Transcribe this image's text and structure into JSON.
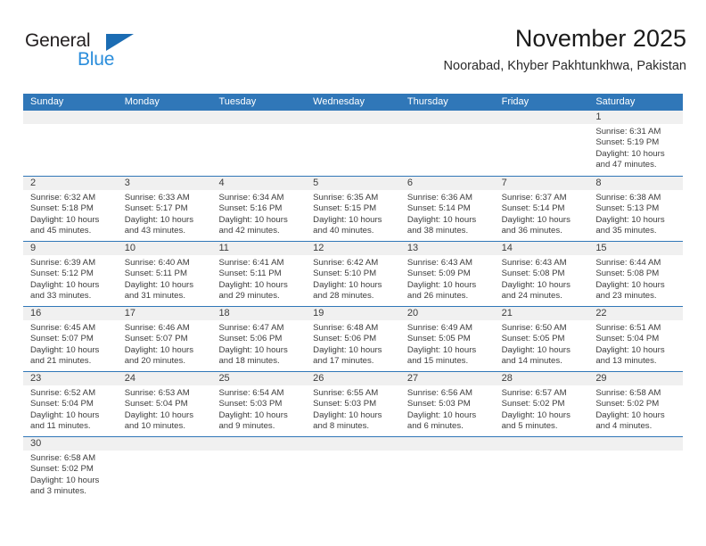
{
  "logo": {
    "word_top": "General",
    "word_bottom": "Blue",
    "triangle_color": "#1b6cb3",
    "blue_text_color": "#2a8ddb"
  },
  "header": {
    "title": "November 2025",
    "subtitle": "Noorabad, Khyber Pakhtunkhwa, Pakistan"
  },
  "theme": {
    "header_blue": "#3077b8",
    "day_band_gray": "#f0f0f0",
    "text_color": "#3c3c3c"
  },
  "weekdays": [
    "Sunday",
    "Monday",
    "Tuesday",
    "Wednesday",
    "Thursday",
    "Friday",
    "Saturday"
  ],
  "weeks": [
    [
      {
        "day": "",
        "empty": true,
        "sunrise": "",
        "sunset": "",
        "daylight_line1": "",
        "daylight_line2": ""
      },
      {
        "day": "",
        "empty": true,
        "sunrise": "",
        "sunset": "",
        "daylight_line1": "",
        "daylight_line2": ""
      },
      {
        "day": "",
        "empty": true,
        "sunrise": "",
        "sunset": "",
        "daylight_line1": "",
        "daylight_line2": ""
      },
      {
        "day": "",
        "empty": true,
        "sunrise": "",
        "sunset": "",
        "daylight_line1": "",
        "daylight_line2": ""
      },
      {
        "day": "",
        "empty": true,
        "sunrise": "",
        "sunset": "",
        "daylight_line1": "",
        "daylight_line2": ""
      },
      {
        "day": "",
        "empty": true,
        "sunrise": "",
        "sunset": "",
        "daylight_line1": "",
        "daylight_line2": ""
      },
      {
        "day": "1",
        "empty": false,
        "sunrise": "Sunrise: 6:31 AM",
        "sunset": "Sunset: 5:19 PM",
        "daylight_line1": "Daylight: 10 hours",
        "daylight_line2": "and 47 minutes."
      }
    ],
    [
      {
        "day": "2",
        "empty": false,
        "sunrise": "Sunrise: 6:32 AM",
        "sunset": "Sunset: 5:18 PM",
        "daylight_line1": "Daylight: 10 hours",
        "daylight_line2": "and 45 minutes."
      },
      {
        "day": "3",
        "empty": false,
        "sunrise": "Sunrise: 6:33 AM",
        "sunset": "Sunset: 5:17 PM",
        "daylight_line1": "Daylight: 10 hours",
        "daylight_line2": "and 43 minutes."
      },
      {
        "day": "4",
        "empty": false,
        "sunrise": "Sunrise: 6:34 AM",
        "sunset": "Sunset: 5:16 PM",
        "daylight_line1": "Daylight: 10 hours",
        "daylight_line2": "and 42 minutes."
      },
      {
        "day": "5",
        "empty": false,
        "sunrise": "Sunrise: 6:35 AM",
        "sunset": "Sunset: 5:15 PM",
        "daylight_line1": "Daylight: 10 hours",
        "daylight_line2": "and 40 minutes."
      },
      {
        "day": "6",
        "empty": false,
        "sunrise": "Sunrise: 6:36 AM",
        "sunset": "Sunset: 5:14 PM",
        "daylight_line1": "Daylight: 10 hours",
        "daylight_line2": "and 38 minutes."
      },
      {
        "day": "7",
        "empty": false,
        "sunrise": "Sunrise: 6:37 AM",
        "sunset": "Sunset: 5:14 PM",
        "daylight_line1": "Daylight: 10 hours",
        "daylight_line2": "and 36 minutes."
      },
      {
        "day": "8",
        "empty": false,
        "sunrise": "Sunrise: 6:38 AM",
        "sunset": "Sunset: 5:13 PM",
        "daylight_line1": "Daylight: 10 hours",
        "daylight_line2": "and 35 minutes."
      }
    ],
    [
      {
        "day": "9",
        "empty": false,
        "sunrise": "Sunrise: 6:39 AM",
        "sunset": "Sunset: 5:12 PM",
        "daylight_line1": "Daylight: 10 hours",
        "daylight_line2": "and 33 minutes."
      },
      {
        "day": "10",
        "empty": false,
        "sunrise": "Sunrise: 6:40 AM",
        "sunset": "Sunset: 5:11 PM",
        "daylight_line1": "Daylight: 10 hours",
        "daylight_line2": "and 31 minutes."
      },
      {
        "day": "11",
        "empty": false,
        "sunrise": "Sunrise: 6:41 AM",
        "sunset": "Sunset: 5:11 PM",
        "daylight_line1": "Daylight: 10 hours",
        "daylight_line2": "and 29 minutes."
      },
      {
        "day": "12",
        "empty": false,
        "sunrise": "Sunrise: 6:42 AM",
        "sunset": "Sunset: 5:10 PM",
        "daylight_line1": "Daylight: 10 hours",
        "daylight_line2": "and 28 minutes."
      },
      {
        "day": "13",
        "empty": false,
        "sunrise": "Sunrise: 6:43 AM",
        "sunset": "Sunset: 5:09 PM",
        "daylight_line1": "Daylight: 10 hours",
        "daylight_line2": "and 26 minutes."
      },
      {
        "day": "14",
        "empty": false,
        "sunrise": "Sunrise: 6:43 AM",
        "sunset": "Sunset: 5:08 PM",
        "daylight_line1": "Daylight: 10 hours",
        "daylight_line2": "and 24 minutes."
      },
      {
        "day": "15",
        "empty": false,
        "sunrise": "Sunrise: 6:44 AM",
        "sunset": "Sunset: 5:08 PM",
        "daylight_line1": "Daylight: 10 hours",
        "daylight_line2": "and 23 minutes."
      }
    ],
    [
      {
        "day": "16",
        "empty": false,
        "sunrise": "Sunrise: 6:45 AM",
        "sunset": "Sunset: 5:07 PM",
        "daylight_line1": "Daylight: 10 hours",
        "daylight_line2": "and 21 minutes."
      },
      {
        "day": "17",
        "empty": false,
        "sunrise": "Sunrise: 6:46 AM",
        "sunset": "Sunset: 5:07 PM",
        "daylight_line1": "Daylight: 10 hours",
        "daylight_line2": "and 20 minutes."
      },
      {
        "day": "18",
        "empty": false,
        "sunrise": "Sunrise: 6:47 AM",
        "sunset": "Sunset: 5:06 PM",
        "daylight_line1": "Daylight: 10 hours",
        "daylight_line2": "and 18 minutes."
      },
      {
        "day": "19",
        "empty": false,
        "sunrise": "Sunrise: 6:48 AM",
        "sunset": "Sunset: 5:06 PM",
        "daylight_line1": "Daylight: 10 hours",
        "daylight_line2": "and 17 minutes."
      },
      {
        "day": "20",
        "empty": false,
        "sunrise": "Sunrise: 6:49 AM",
        "sunset": "Sunset: 5:05 PM",
        "daylight_line1": "Daylight: 10 hours",
        "daylight_line2": "and 15 minutes."
      },
      {
        "day": "21",
        "empty": false,
        "sunrise": "Sunrise: 6:50 AM",
        "sunset": "Sunset: 5:05 PM",
        "daylight_line1": "Daylight: 10 hours",
        "daylight_line2": "and 14 minutes."
      },
      {
        "day": "22",
        "empty": false,
        "sunrise": "Sunrise: 6:51 AM",
        "sunset": "Sunset: 5:04 PM",
        "daylight_line1": "Daylight: 10 hours",
        "daylight_line2": "and 13 minutes."
      }
    ],
    [
      {
        "day": "23",
        "empty": false,
        "sunrise": "Sunrise: 6:52 AM",
        "sunset": "Sunset: 5:04 PM",
        "daylight_line1": "Daylight: 10 hours",
        "daylight_line2": "and 11 minutes."
      },
      {
        "day": "24",
        "empty": false,
        "sunrise": "Sunrise: 6:53 AM",
        "sunset": "Sunset: 5:04 PM",
        "daylight_line1": "Daylight: 10 hours",
        "daylight_line2": "and 10 minutes."
      },
      {
        "day": "25",
        "empty": false,
        "sunrise": "Sunrise: 6:54 AM",
        "sunset": "Sunset: 5:03 PM",
        "daylight_line1": "Daylight: 10 hours",
        "daylight_line2": "and 9 minutes."
      },
      {
        "day": "26",
        "empty": false,
        "sunrise": "Sunrise: 6:55 AM",
        "sunset": "Sunset: 5:03 PM",
        "daylight_line1": "Daylight: 10 hours",
        "daylight_line2": "and 8 minutes."
      },
      {
        "day": "27",
        "empty": false,
        "sunrise": "Sunrise: 6:56 AM",
        "sunset": "Sunset: 5:03 PM",
        "daylight_line1": "Daylight: 10 hours",
        "daylight_line2": "and 6 minutes."
      },
      {
        "day": "28",
        "empty": false,
        "sunrise": "Sunrise: 6:57 AM",
        "sunset": "Sunset: 5:02 PM",
        "daylight_line1": "Daylight: 10 hours",
        "daylight_line2": "and 5 minutes."
      },
      {
        "day": "29",
        "empty": false,
        "sunrise": "Sunrise: 6:58 AM",
        "sunset": "Sunset: 5:02 PM",
        "daylight_line1": "Daylight: 10 hours",
        "daylight_line2": "and 4 minutes."
      }
    ],
    [
      {
        "day": "30",
        "empty": false,
        "sunrise": "Sunrise: 6:58 AM",
        "sunset": "Sunset: 5:02 PM",
        "daylight_line1": "Daylight: 10 hours",
        "daylight_line2": "and 3 minutes."
      },
      {
        "day": "",
        "empty": true,
        "sunrise": "",
        "sunset": "",
        "daylight_line1": "",
        "daylight_line2": ""
      },
      {
        "day": "",
        "empty": true,
        "sunrise": "",
        "sunset": "",
        "daylight_line1": "",
        "daylight_line2": ""
      },
      {
        "day": "",
        "empty": true,
        "sunrise": "",
        "sunset": "",
        "daylight_line1": "",
        "daylight_line2": ""
      },
      {
        "day": "",
        "empty": true,
        "sunrise": "",
        "sunset": "",
        "daylight_line1": "",
        "daylight_line2": ""
      },
      {
        "day": "",
        "empty": true,
        "sunrise": "",
        "sunset": "",
        "daylight_line1": "",
        "daylight_line2": ""
      },
      {
        "day": "",
        "empty": true,
        "sunrise": "",
        "sunset": "",
        "daylight_line1": "",
        "daylight_line2": ""
      }
    ]
  ]
}
